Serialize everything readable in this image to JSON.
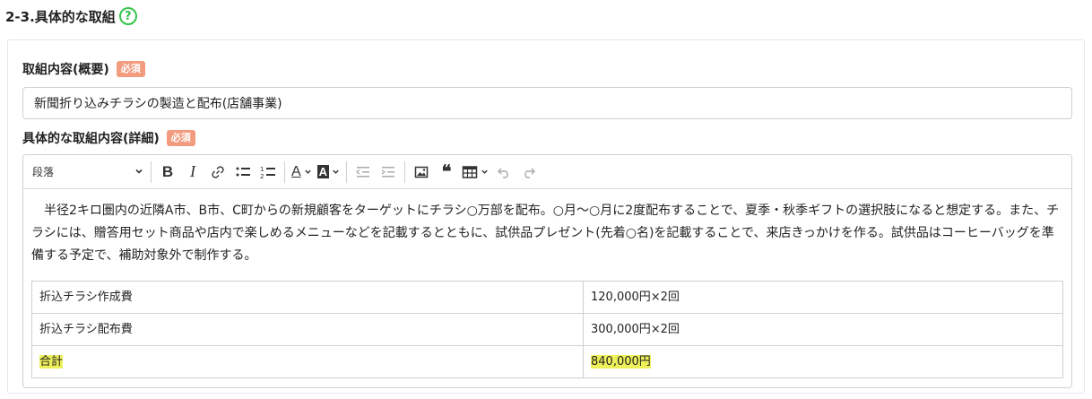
{
  "section": {
    "title": "2-3.具体的な取組",
    "help_icon": "question-circle-icon",
    "help_color": "#35c34a"
  },
  "summary_field": {
    "label": "取組内容(概要)",
    "required_badge": "必須",
    "value": "新聞折り込みチラシの製造と配布(店舗事業)"
  },
  "detail_field": {
    "label": "具体的な取組内容(詳細)",
    "required_badge": "必須"
  },
  "toolbar": {
    "heading_select": "段落",
    "buttons": [
      {
        "name": "bold-icon",
        "glyph": "B"
      },
      {
        "name": "italic-icon",
        "glyph": "I"
      },
      {
        "name": "link-icon"
      },
      {
        "name": "bulleted-list-icon"
      },
      {
        "name": "numbered-list-icon"
      },
      {
        "name": "font-color-icon",
        "glyph": "A"
      },
      {
        "name": "font-background-color-icon",
        "glyph": "A"
      },
      {
        "name": "outdent-icon"
      },
      {
        "name": "indent-icon"
      },
      {
        "name": "image-icon"
      },
      {
        "name": "blockquote-icon"
      },
      {
        "name": "table-icon"
      },
      {
        "name": "undo-icon"
      },
      {
        "name": "redo-icon"
      }
    ]
  },
  "editor": {
    "paragraph": "半径2キロ圏内の近隣A市、B市、C町からの新規顧客をターゲットにチラシ○万部を配布。○月～○月に2度配布することで、夏季・秋季ギフトの選択肢になると想定する。また、チラシには、贈答用セット商品や店内で楽しめるメニューなどを記載するとともに、試供品プレゼント(先着○名)を記載することで、来店きっかけを作る。試供品はコーヒーバッグを準備する予定で、補助対象外で制作する。",
    "table": {
      "rows": [
        {
          "item": "折込チラシ作成費",
          "amount": "120,000円×2回"
        },
        {
          "item": "折込チラシ配布費",
          "amount": "300,000円×2回"
        },
        {
          "item": "合計",
          "amount": "840,000円"
        }
      ]
    },
    "highlight_color": "#eef05a"
  },
  "colors": {
    "required_badge": "#f29b7e",
    "border": "#d0d0d0"
  }
}
